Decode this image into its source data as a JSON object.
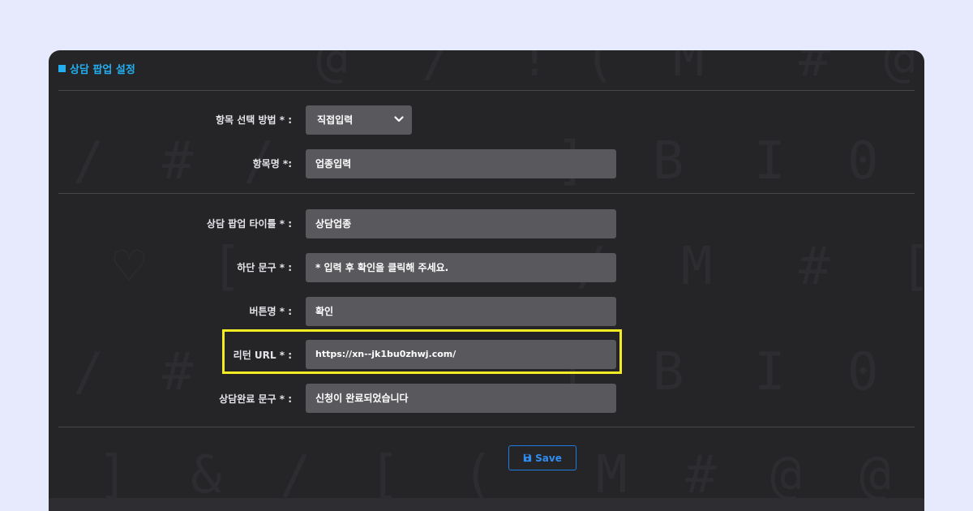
{
  "section": {
    "title": "상담 팝업 설정"
  },
  "fields": {
    "item_method": {
      "label": "항목 선택 방법 * :",
      "value": "직접입력"
    },
    "item_name": {
      "label": "항목명 *:",
      "value": "업종입력"
    },
    "popup_title": {
      "label": "상담 팝업 타이틀 * :",
      "value": "상담업종"
    },
    "footer_text": {
      "label": "하단 문구 * :",
      "value": "* 입력 후 확인을 클릭해 주세요."
    },
    "button_name": {
      "label": "버튼명 * :",
      "value": "확인"
    },
    "return_url": {
      "label": "리턴 URL * :",
      "value": "https://xn--jk1bu0zhwj.com/"
    },
    "complete_text": {
      "label": "상담완료 문구 * :",
      "value": "신청이 완료되었습니다"
    }
  },
  "actions": {
    "save_label": "Save"
  },
  "background_glyphs": [
    "@",
    "/",
    "!",
    "(",
    "M",
    "#",
    "@",
    "/",
    "#",
    "/",
    "]",
    "B",
    "I",
    "0",
    "♡",
    "[",
    "/",
    "M",
    "#",
    "[",
    "/",
    "#",
    "]",
    "B",
    "I",
    "0",
    "]",
    "&",
    "/",
    "[",
    "(",
    "M",
    "#",
    "@",
    "@"
  ],
  "colors": {
    "accent": "#23aef0",
    "highlight": "#f3ec24",
    "button": "#1e7ce0",
    "panel": "#252528",
    "field": "#59595d"
  }
}
